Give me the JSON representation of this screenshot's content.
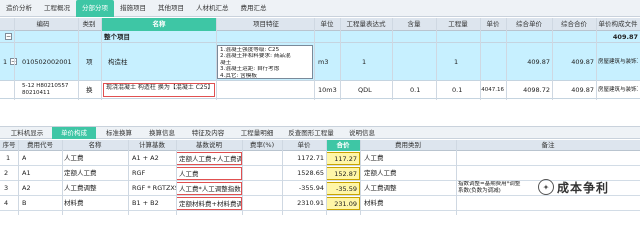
{
  "top_tabs": [
    "造价分析",
    "工程概况",
    "分部分项",
    "措施项目",
    "其他项目",
    "人材机汇总",
    "费用汇总"
  ],
  "top_tab_active": 2,
  "upper_grid": {
    "headers": [
      "编码",
      "类别",
      "名称",
      "项目特征",
      "单位",
      "工程量表达式",
      "含量",
      "工程量",
      "单价",
      "综合单价",
      "综合合价",
      "单价构成文件"
    ],
    "sub_row": {
      "name": "整个项目",
      "total": "409.87"
    },
    "qd_row": {
      "no": "1",
      "code": "010502002001",
      "type": "项",
      "name": "构造柱",
      "features": [
        "1.混凝土强度等级: C25",
        "2.混凝土拌和料要求: 商品混",
        "凝土",
        "3.混凝土运距: 自行考虑",
        "4.其它: 含模板"
      ],
      "unit": "m3",
      "expr": "1",
      "qty": "1",
      "unit_price": "409.87",
      "total": "409.87",
      "file": "房屋建筑与装饰工程"
    },
    "de_row": {
      "code": "5-12 H80210557 80210411",
      "type": "换",
      "name": "现浇混凝土 构造柱  换为【混凝土 C25】",
      "unit": "10m3",
      "expr": "QDL",
      "content": "0.1",
      "qty": "0.1",
      "price": "4047.16",
      "unit_price": "4098.72",
      "total": "409.87",
      "file": "房屋建筑与装饰工程"
    }
  },
  "bottom_tabs": [
    "工料机显示",
    "单价构成",
    "标准换算",
    "换算信息",
    "特征及内容",
    "工程量明细",
    "反查图形工程量",
    "说明信息"
  ],
  "bottom_tab_active": 1,
  "lower_grid": {
    "headers": [
      "序号",
      "费用代号",
      "名称",
      "计算基数",
      "基数说明",
      "费率(%)",
      "单价",
      "合价",
      "费用类别",
      "备注"
    ],
    "rows": [
      {
        "seq": "1",
        "code": "A",
        "name": "人工费",
        "base": "A1 + A2",
        "desc": "定额人工费+人工费调整",
        "rate": "",
        "price": "1172.71",
        "total": "117.27",
        "cat": "人工费",
        "note": ""
      },
      {
        "seq": "2",
        "code": "A1",
        "name": "定额人工费",
        "base": "RGF",
        "desc": "人工费",
        "rate": "",
        "price": "1528.65",
        "total": "152.87",
        "cat": "定额人工费",
        "note": ""
      },
      {
        "seq": "3",
        "code": "A2",
        "name": "人工费调整",
        "base": "RGF * RGTZXS",
        "desc": "人工费*人工调整指数",
        "rate": "",
        "price": "-355.94",
        "total": "-35.59",
        "cat": "人工费调整",
        "note": "指数调整=基期费用*调整系数(负数为调减)"
      },
      {
        "seq": "4",
        "code": "B",
        "name": "材料费",
        "base": "B1 + B2",
        "desc": "定额材料费+材料费调整",
        "rate": "",
        "price": "2310.91",
        "total": "231.09",
        "cat": "材料费",
        "note": ""
      }
    ]
  },
  "watermark": "成本争利"
}
